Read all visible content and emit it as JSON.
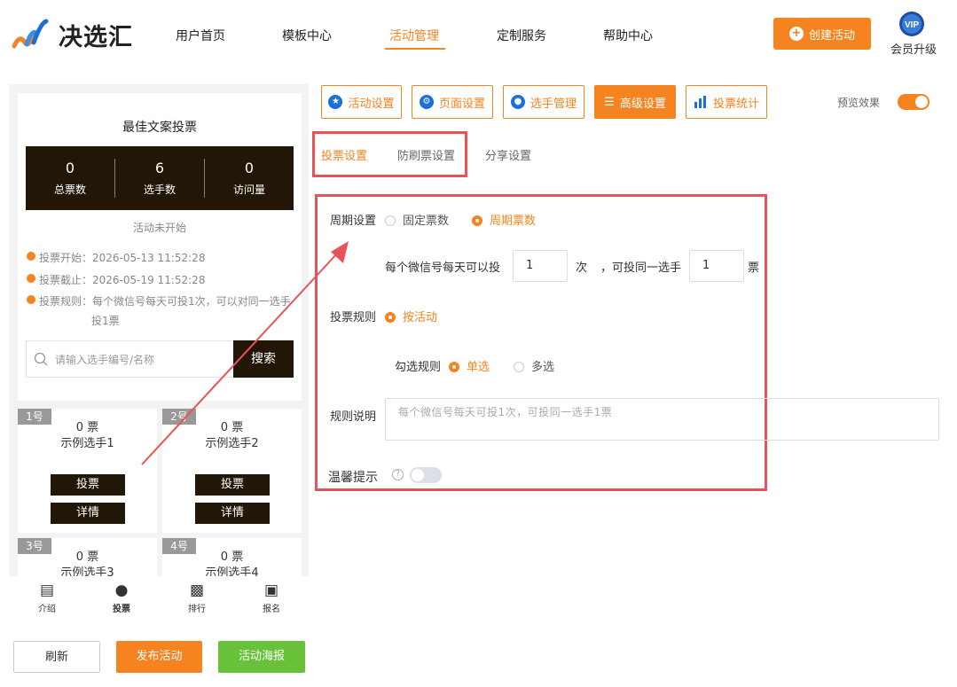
{
  "header": {
    "brand": "决选汇",
    "nav": [
      "用户首页",
      "模板中心",
      "活动管理",
      "定制服务",
      "帮助中心"
    ],
    "create_button": "创建活动",
    "vip_badge": "VIP",
    "vip_label": "会员升级"
  },
  "preview": {
    "activity_title": "最佳文案投票",
    "stats": [
      {
        "value": "0",
        "label": "总票数"
      },
      {
        "value": "6",
        "label": "选手数"
      },
      {
        "value": "0",
        "label": "访问量"
      }
    ],
    "status": "活动未开始",
    "vote_start": "投票开始：2026-05-13 11:52:28",
    "vote_end": "投票截止：2026-05-19 11:52:28",
    "rule_line1": "投票规则：每个微信号每天可投1次，可以对同一选手",
    "rule_line2": "投1票",
    "search_placeholder": "请输入选手编号/名称",
    "search_button": "搜索",
    "players": [
      {
        "badge": "1号",
        "votes": "0 票",
        "name": "示例选手1"
      },
      {
        "badge": "2号",
        "votes": "0 票",
        "name": "示例选手2"
      },
      {
        "badge": "3号",
        "votes": "0 票",
        "name": "示例选手3"
      },
      {
        "badge": "4号",
        "votes": "0 票",
        "name": "示例选手4"
      }
    ],
    "vote_button": "投票",
    "detail_button": "详情",
    "tabs": [
      {
        "label": "介绍",
        "icon": "intro-icon"
      },
      {
        "label": "投票",
        "icon": "person-icon"
      },
      {
        "label": "排行",
        "icon": "ranking-icon"
      },
      {
        "label": "报名",
        "icon": "signup-icon"
      }
    ]
  },
  "bottom_buttons": {
    "refresh": "刷新",
    "publish": "发布活动",
    "poster": "活动海报"
  },
  "toolbar": {
    "items": [
      "活动设置",
      "页面设置",
      "选手管理",
      "高级设置",
      "投票统计"
    ],
    "active": "高级设置",
    "preview_label": "预览效果"
  },
  "subtabs": {
    "items": [
      "投票设置",
      "防刷票设置",
      "分享设置"
    ],
    "active": "投票设置"
  },
  "form": {
    "period_label": "周期设置",
    "period_options": [
      "固定票数",
      "周期票数"
    ],
    "period_selected": "周期票数",
    "per_day_prefix": "每个微信号每天可以投",
    "per_day_value": "1",
    "per_day_unit": "次",
    "same_player_prefix": "，可投同一选手",
    "same_player_value": "1",
    "same_player_unit": "票",
    "rule_label": "投票规则",
    "rule_option": "按活动",
    "check_rule_label": "勾选规则",
    "check_options": [
      "单选",
      "多选"
    ],
    "check_selected": "单选",
    "desc_label": "规则说明",
    "desc_placeholder": "每个微信号每天可投1次，可投同一选手1票",
    "tip_label": "温馨提示",
    "tip_help": "?",
    "tip_enabled": false
  },
  "colors": {
    "accent": "#f5831f",
    "dark": "#221707",
    "highlight": "#e8535a",
    "green": "#67c23a"
  }
}
